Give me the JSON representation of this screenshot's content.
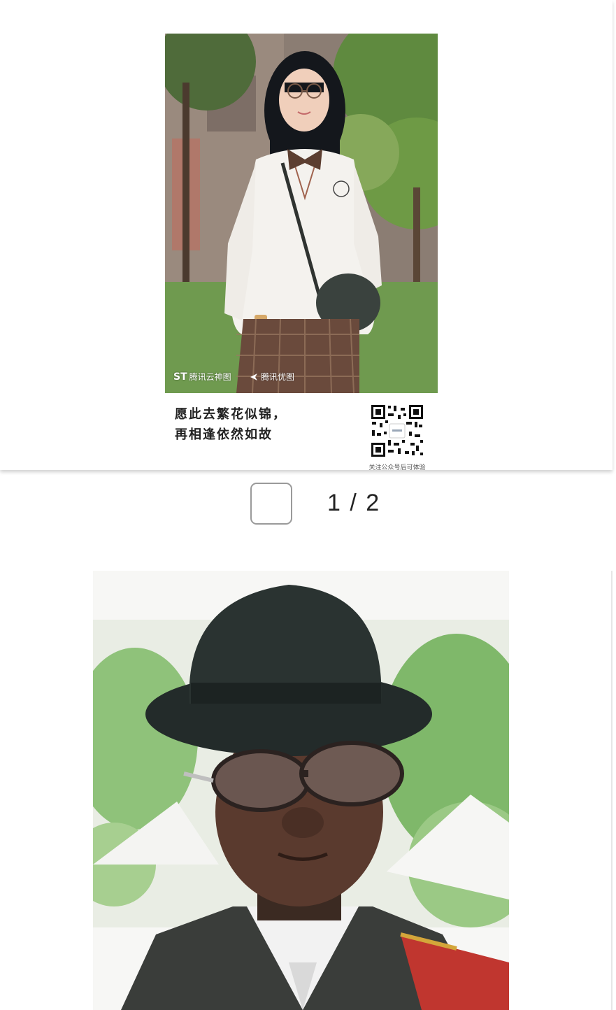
{
  "post": {
    "card1": {
      "watermark_left": "腾讯云神图",
      "watermark_left_logo": "ST",
      "watermark_right": "腾讯优图",
      "caption_line1": "愿此去繁花似锦，",
      "caption_line2": "再相逢依然如故",
      "qr_caption": "关注公众号后可体验"
    },
    "pager": {
      "text": "1 / 2",
      "checkbox_checked": false
    }
  },
  "colors": {
    "sweater": "#f4f2ee",
    "skirt": "#6a4a3c",
    "grass": "#6f9a4f",
    "hat": "#222a2a"
  }
}
